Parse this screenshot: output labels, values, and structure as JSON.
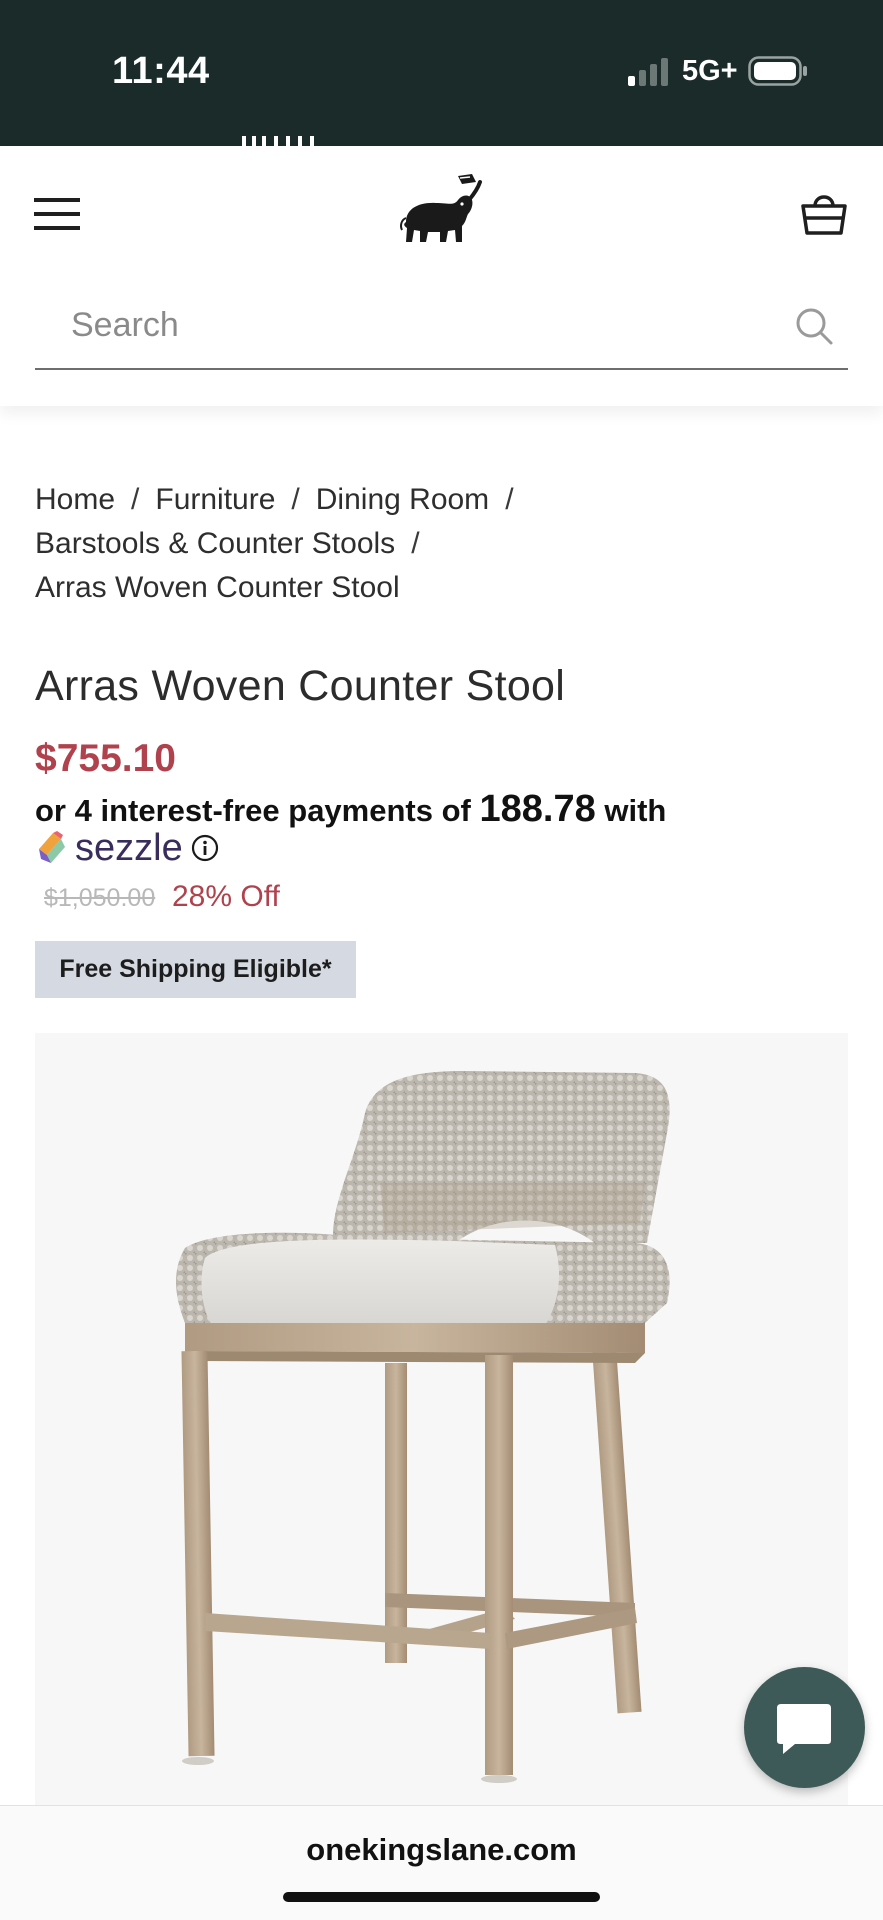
{
  "status_bar": {
    "time": "11:44",
    "network": "5G+"
  },
  "header": {
    "logo_icon": "elephant-logo-icon",
    "menu_icon": "hamburger-menu-icon",
    "cart_icon": "shopping-basket-icon"
  },
  "search": {
    "placeholder": "Search",
    "icon": "search-icon"
  },
  "breadcrumb": {
    "items": [
      "Home",
      "Furniture",
      "Dining Room",
      "Barstools & Counter Stools",
      "Arras Woven Counter Stool"
    ],
    "separator": "/"
  },
  "product": {
    "title": "Arras Woven Counter Stool",
    "price": "$755.10",
    "installment_prefix": "or 4 interest-free payments of",
    "installment_amount": "188.78",
    "installment_suffix": "with",
    "installment_provider": "sezzle",
    "original_price": "$1,050.00",
    "discount": "28% Off",
    "shipping_badge": "Free Shipping Eligible*"
  },
  "chat": {
    "icon": "chat-bubble-icon"
  },
  "browser": {
    "url": "onekingslane.com"
  },
  "colors": {
    "status_bar_bg": "#1b2b2a",
    "price_red": "#b0424d",
    "badge_bg": "#d4d9e2",
    "chat_button": "#3e5a58",
    "sezzle_purple": "#392d5e"
  }
}
